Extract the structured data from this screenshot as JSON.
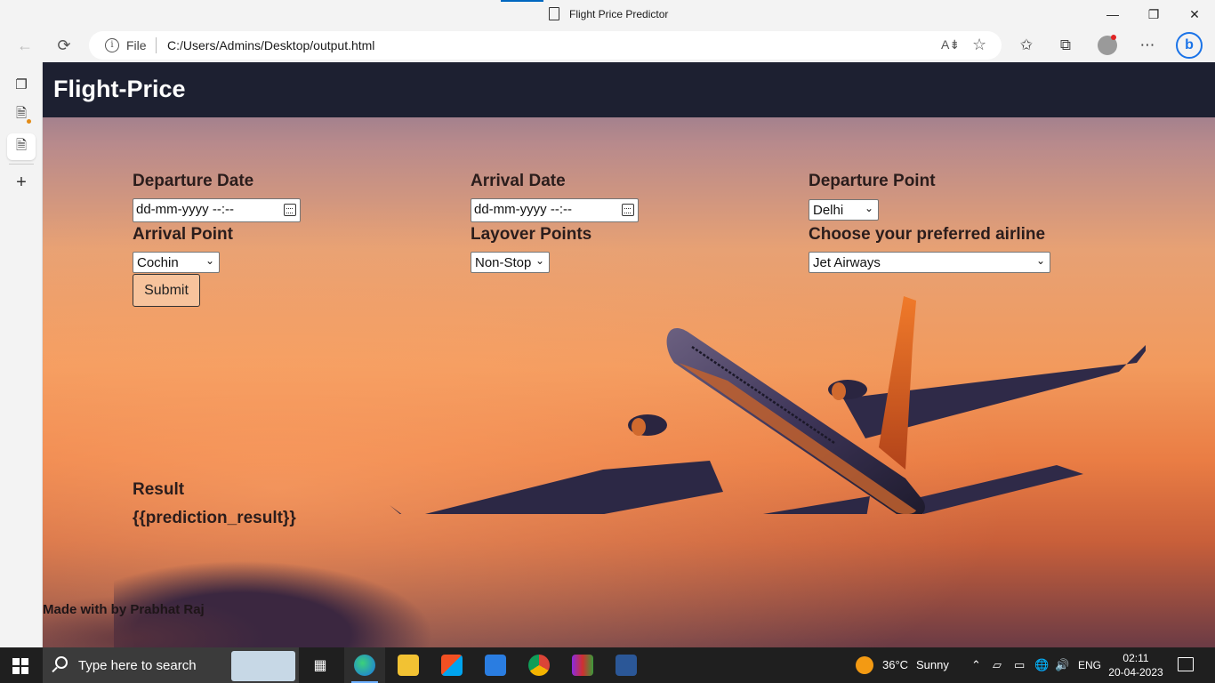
{
  "browser": {
    "window_title": "Flight Price Predictor",
    "address": {
      "protocol_label": "File",
      "url": "C:/Users/Admins/Desktop/output.html"
    }
  },
  "header": {
    "brand": "Flight-Price"
  },
  "form": {
    "departure_date": {
      "label": "Departure Date",
      "placeholder": "dd-mm-yyyy --:--"
    },
    "arrival_date": {
      "label": "Arrival Date",
      "placeholder": "dd-mm-yyyy --:--"
    },
    "departure_point": {
      "label": "Departure Point",
      "value": "Delhi"
    },
    "arrival_point": {
      "label": "Arrival Point",
      "value": "Cochin"
    },
    "layover_points": {
      "label": "Layover Points",
      "value": "Non-Stop"
    },
    "airline": {
      "label": "Choose your preferred airline",
      "value": "Jet Airways"
    },
    "submit_label": "Submit"
  },
  "result": {
    "label": "Result",
    "value": "{{prediction_result}}"
  },
  "footer": {
    "text": "Made with by Prabhat Raj"
  },
  "taskbar": {
    "search_placeholder": "Type here to search",
    "weather": {
      "temperature": "36°C",
      "condition": "Sunny"
    },
    "language": "ENG",
    "time": "02:11",
    "date": "20-04-2023"
  },
  "colors": {
    "header_bg": "#1d2031",
    "submit_bg": "#f7c39c",
    "label_text": "#2b1d1c"
  }
}
